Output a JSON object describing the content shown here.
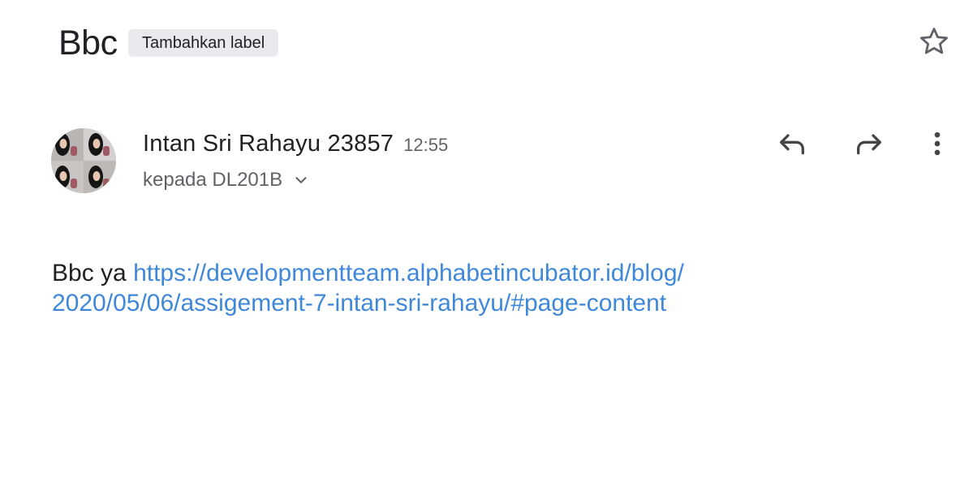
{
  "header": {
    "subject": "Bbc",
    "label_chip": "Tambahkan label",
    "star_icon": "star-outline-icon"
  },
  "message": {
    "sender_name": "Intan Sri Rahayu 23857",
    "time": "12:55",
    "recipient": "kepada DL201B",
    "expand_icon": "chevron-down-icon",
    "actions": {
      "reply_icon": "reply-icon",
      "forward_icon": "forward-icon",
      "more_icon": "more-vert-icon"
    },
    "body_prefix": "Bbc ya ",
    "body_link": "https://developmentteam.alphabetincubator.id/blog/2020/05/06/assigement-7-intan-sri-rahayu/#page-content"
  },
  "colors": {
    "link": "#3f88d9",
    "text": "#202124",
    "secondary_text": "#5f6368",
    "chip_bg": "#e8eaed"
  }
}
